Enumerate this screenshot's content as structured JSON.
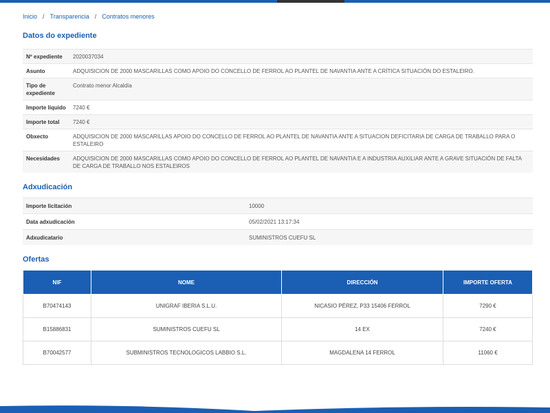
{
  "breadcrumb": [
    "Inicio",
    "Transparencia",
    "Contratos menores"
  ],
  "breadcrumb_sep": "/",
  "datos": {
    "title": "Datos do expediente",
    "rows": [
      {
        "label": "Nº expediente",
        "value": "2020037034"
      },
      {
        "label": "Asunto",
        "value": "ADQUISICION DE 2000 MASCARILLAS COMO APOIO DO CONCELLO DE FERROL AO PLANTEL DE NAVANTIA ANTE A CRÍTICA SITUACIÓN DO ESTALEIRO."
      },
      {
        "label": "Tipo de expediente",
        "value": "Contrato menor Alcaldía"
      },
      {
        "label": "Importe líquido",
        "value": "7240 €"
      },
      {
        "label": "Importe total",
        "value": "7240 €"
      },
      {
        "label": "Obxecto",
        "value": "ADQUISICION DE 2000 MASCARILLAS APOIO DO CONCELLO DE FERROL AO PLANTEL DE NAVANTIA ANTE A SITUACION DEFICITARIA DE CARGA DE TRABALLO PARA O ESTALEIRO"
      },
      {
        "label": "Necesidades",
        "value": "ADQUISICION DE 2000 MASCARILLAS COMO APOIO DO CONCELLO DE FERROL AO PLANTEL DE NAVANTIA E A INDUSTRIA AUXILIAR ANTE A GRAVE SITUACIÓN DE FALTA DE CARGA DE TRABALLO NOS ESTALEIROS"
      }
    ]
  },
  "adxudicacion": {
    "title": "Adxudicación",
    "rows": [
      {
        "label": "Importe licitación",
        "value": "10000"
      },
      {
        "label": "Data adxudicación",
        "value": "05/02/2021 13:17:34"
      },
      {
        "label": "Adxudicatario",
        "value": "SUMINISTROS CUEFU SL"
      }
    ]
  },
  "ofertas": {
    "title": "Ofertas",
    "headers": [
      "NIF",
      "NOME",
      "DIRECCIÓN",
      "IMPORTE OFERTA"
    ],
    "rows": [
      [
        "B70474143",
        "UNIGRAF IBERIA S.L.U.",
        "NICASIO PÉREZ, P33 15406 FERROL",
        "7290 €"
      ],
      [
        "B15886831",
        "SUMINISTROS CUEFU SL",
        "14 EX",
        "7240 €"
      ],
      [
        "B70042577",
        "SUBMINISTROS TECNOLOGICOS LABBIO S.L.",
        "MAGDALENA 14 FERROL",
        "11060 €"
      ]
    ]
  },
  "colors": {
    "accent": "#1a5fb4",
    "dark_bar": "#333333"
  }
}
